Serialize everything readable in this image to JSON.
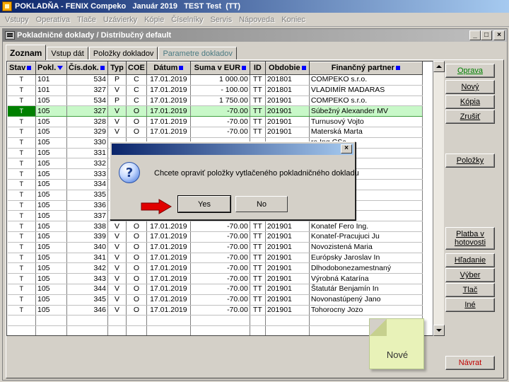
{
  "app": {
    "title": "POKLADŇA - FENIX Compeko   Január 2019   TEST Test  (TT)"
  },
  "menu": [
    "Vstupy",
    "Operatíva",
    "Tlače",
    "Uzávierky",
    "Kópie",
    "Číselníky",
    "Servis",
    "Nápoveda",
    "Koniec"
  ],
  "child": {
    "title": "Pokladničné doklady / Distribučný default",
    "win_minimize": "_",
    "win_restore": "□",
    "win_close": "×"
  },
  "tabs": [
    "Zoznam",
    "Vstup dát",
    "Položky dokladov",
    "Parametre dokladov"
  ],
  "grid": {
    "columns": [
      "Stav",
      "Pokl.",
      "Čís.dok.",
      "Typ",
      "COE",
      "Dátum",
      "Suma v EUR",
      "ID",
      "Obdobie",
      "Finančný partner"
    ],
    "rows": [
      [
        "T",
        "101",
        "534",
        "P",
        "C",
        "17.01.2019",
        "1 000.00",
        "TT",
        "201801",
        "COMPEKO s.r.o."
      ],
      [
        "T",
        "101",
        "327",
        "V",
        "C",
        "17.01.2019",
        "- 100.00",
        "TT",
        "201801",
        "VLADIMÍR MADARAS"
      ],
      [
        "T",
        "105",
        "534",
        "P",
        "C",
        "17.01.2019",
        "1 750.00",
        "TT",
        "201901",
        "COMPEKO s.r.o."
      ],
      [
        "T",
        "105",
        "327",
        "V",
        "O",
        "17.01.2019",
        "-70.00",
        "TT",
        "201901",
        "Súbežný Alexander MV"
      ],
      [
        "T",
        "105",
        "328",
        "V",
        "O",
        "17.01.2019",
        "-70.00",
        "TT",
        "201901",
        "Turnusový Vojto"
      ],
      [
        "T",
        "105",
        "329",
        "V",
        "O",
        "17.01.2019",
        "-70.00",
        "TT",
        "201901",
        "Materská Marta"
      ],
      [
        "T",
        "105",
        "330",
        "",
        "",
        "",
        "",
        "",
        "",
        "ra Ing.CSc."
      ],
      [
        "T",
        "105",
        "331",
        "",
        "",
        "",
        "",
        "",
        "",
        ""
      ],
      [
        "T",
        "105",
        "332",
        "",
        "",
        "",
        "",
        "",
        "",
        "opný Ján"
      ],
      [
        "T",
        "105",
        "333",
        "",
        "",
        "",
        "",
        "",
        "",
        "borý Marian"
      ],
      [
        "T",
        "105",
        "334",
        "",
        "",
        "",
        "",
        "",
        "",
        "ská Pavlí"
      ],
      [
        "T",
        "105",
        "335",
        "",
        "",
        "",
        "",
        "",
        "",
        "olný Ján"
      ],
      [
        "T",
        "105",
        "336",
        "",
        "",
        "",
        "",
        "",
        "",
        "Ján"
      ],
      [
        "T",
        "105",
        "337",
        "",
        "",
        "",
        "",
        "",
        "",
        "ol"
      ],
      [
        "T",
        "105",
        "338",
        "V",
        "O",
        "17.01.2019",
        "-70.00",
        "TT",
        "201901",
        "Konateľ Fero Ing."
      ],
      [
        "T",
        "105",
        "339",
        "V",
        "O",
        "17.01.2019",
        "-70.00",
        "TT",
        "201901",
        "Konateľ-Pracujuci Ju"
      ],
      [
        "T",
        "105",
        "340",
        "V",
        "O",
        "17.01.2019",
        "-70.00",
        "TT",
        "201901",
        "Novozistená Maria"
      ],
      [
        "T",
        "105",
        "341",
        "V",
        "O",
        "17.01.2019",
        "-70.00",
        "TT",
        "201901",
        "Európsky Jaroslav In"
      ],
      [
        "T",
        "105",
        "342",
        "V",
        "O",
        "17.01.2019",
        "-70.00",
        "TT",
        "201901",
        "Dlhodobonezamestnaný"
      ],
      [
        "T",
        "105",
        "343",
        "V",
        "O",
        "17.01.2019",
        "-70.00",
        "TT",
        "201901",
        "Výrobná Katarína"
      ],
      [
        "T",
        "105",
        "344",
        "V",
        "O",
        "17.01.2019",
        "-70.00",
        "TT",
        "201901",
        "Štatutár Benjamín In"
      ],
      [
        "T",
        "105",
        "345",
        "V",
        "O",
        "17.01.2019",
        "-70.00",
        "TT",
        "201901",
        "Novonastúpený Jano"
      ],
      [
        "T",
        "105",
        "346",
        "V",
        "O",
        "17.01.2019",
        "-70.00",
        "TT",
        "201901",
        "Tohorocny Jozo"
      ]
    ],
    "selected_row": 3,
    "empty_rows": 3
  },
  "side_buttons": {
    "oprava": "Oprava",
    "novy": "Nový",
    "kopia": "Kópia",
    "zrusit": "Zrušiť",
    "polozky": "Položky",
    "platba": "Platba v hotovosti",
    "hladanie": "Hľadanie",
    "vyber": "Výber",
    "tlac": "Tlač",
    "ine": "Iné",
    "navrat": "Návrat"
  },
  "note": {
    "text": "Nové"
  },
  "dialog": {
    "close": "×",
    "message": "Chcete opraviť položky vytlačeného pokladničného dokladu",
    "icon": "?",
    "yes": "Yes",
    "no": "No"
  },
  "colors": {
    "selected_row": "#c8f8c8",
    "selected_indicator": "#008000",
    "sort_indicator": "#0000ff",
    "arrow": "#e00000"
  }
}
